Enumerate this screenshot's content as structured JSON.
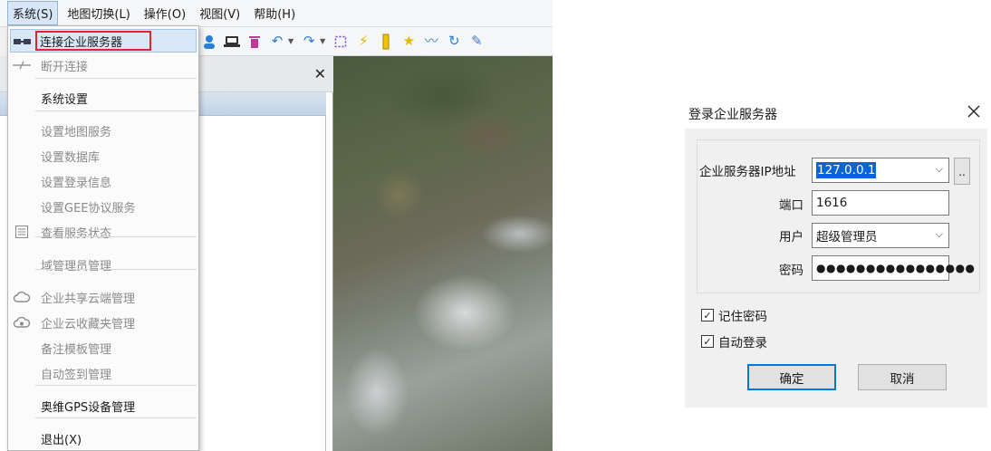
{
  "menubar": {
    "items": [
      "系统(S)",
      "地图切换(L)",
      "操作(O)",
      "视图(V)",
      "帮助(H)"
    ]
  },
  "sidepanel": {
    "close_glyph": "✕"
  },
  "system_menu": {
    "items": [
      {
        "label": "连接企业服务器",
        "state": "highlighted",
        "icon": "connect-icon"
      },
      {
        "label": "断开连接",
        "state": "disabled",
        "icon": "disconnect-icon"
      },
      {
        "label": "系统设置",
        "state": "enabled",
        "icon": ""
      },
      {
        "label": "设置地图服务",
        "state": "disabled",
        "icon": ""
      },
      {
        "label": "设置数据库",
        "state": "disabled",
        "icon": ""
      },
      {
        "label": "设置登录信息",
        "state": "disabled",
        "icon": ""
      },
      {
        "label": "设置GEE协议服务",
        "state": "disabled",
        "icon": ""
      },
      {
        "label": "查看服务状态",
        "state": "disabled",
        "icon": "list-icon"
      },
      {
        "label": "域管理员管理",
        "state": "disabled",
        "icon": ""
      },
      {
        "label": "企业共享云端管理",
        "state": "disabled",
        "icon": "cloud-icon"
      },
      {
        "label": "企业云收藏夹管理",
        "state": "disabled",
        "icon": "cloud-eye-icon"
      },
      {
        "label": "备注模板管理",
        "state": "disabled",
        "icon": ""
      },
      {
        "label": "自动签到管理",
        "state": "disabled",
        "icon": ""
      },
      {
        "label": "奥维GPS设备管理",
        "state": "enabled",
        "icon": ""
      },
      {
        "label": "退出(X)",
        "state": "enabled",
        "icon": ""
      }
    ]
  },
  "login_dialog": {
    "title": "登录企业服务器",
    "ip_label": "企业服务器IP地址",
    "ip_value": "127.0.0.1",
    "more_button": "..",
    "port_label": "端口",
    "port_value": "1616",
    "user_label": "用户",
    "user_value": "超级管理员",
    "password_label": "密码",
    "password_value": "●●●●●●●●●●●●●●●●",
    "remember_label": "记住密码",
    "remember_checked": true,
    "autologin_label": "自动登录",
    "autologin_checked": true,
    "ok_button": "确定",
    "cancel_button": "取消"
  },
  "colors": {
    "highlight_border": "#e0262b",
    "selection": "#0a64d6",
    "primary_button_border": "#0078d7"
  }
}
